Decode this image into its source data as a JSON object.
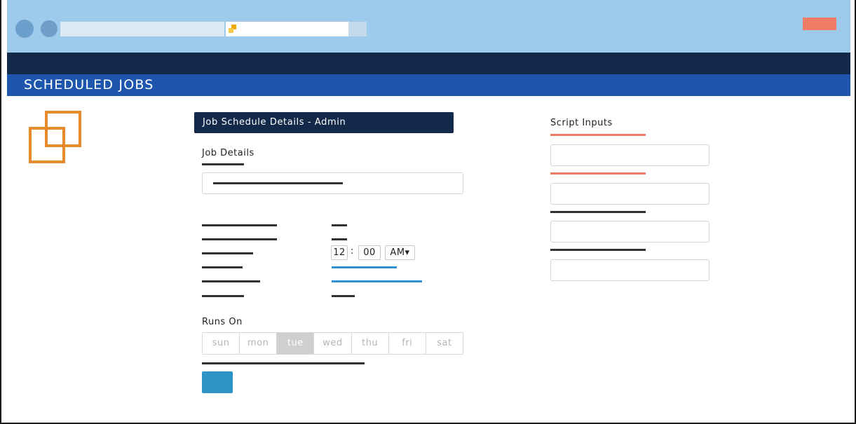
{
  "app": {
    "title": "SCHEDULED JOBS"
  },
  "panel": {
    "header": "Job Schedule Details - Admin"
  },
  "job_details": {
    "title": "Job Details"
  },
  "time": {
    "hour": "12",
    "separator": ":",
    "minute": "00",
    "period": "AM▾"
  },
  "runs_on": {
    "title": "Runs On",
    "days": [
      "sun",
      "mon",
      "tue",
      "wed",
      "thu",
      "fri",
      "sat"
    ],
    "selected": "tue"
  },
  "script_inputs": {
    "title": "Script Inputs"
  },
  "colors": {
    "chrome": "#9ecbec",
    "nav_dark": "#13294a",
    "app_bar": "#1e56ae",
    "accent_orange": "#e8892b",
    "close_red": "#f07c66",
    "link_blue": "#2f92d6",
    "button_blue": "#2b93c6"
  },
  "icons": {
    "logo": "overlapping-squares-logo-icon",
    "browser_lock": "lock-icon"
  }
}
